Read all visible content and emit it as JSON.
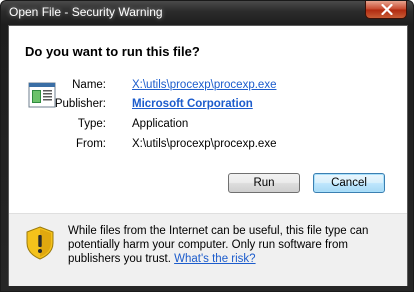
{
  "window": {
    "title": "Open File - Security Warning",
    "close_icon": "close-icon"
  },
  "dialog": {
    "heading": "Do you want to run this file?",
    "file_icon": "application-icon",
    "fields": {
      "name_label": "Name:",
      "name_value": "X:\\utils\\procexp\\procexp.exe",
      "publisher_label": "Publisher:",
      "publisher_value": "Microsoft Corporation",
      "type_label": "Type:",
      "type_value": "Application",
      "from_label": "From:",
      "from_value": "X:\\utils\\procexp\\procexp.exe"
    },
    "buttons": {
      "run": "Run",
      "cancel": "Cancel"
    }
  },
  "warning": {
    "icon": "warning-shield-icon",
    "text": "While files from the Internet can be useful, this file type can potentially harm your computer. Only run software from publishers you trust.",
    "link": "What's the risk?"
  },
  "colors": {
    "link": "#1c5ccc",
    "shield_yellow": "#f4c21b"
  }
}
